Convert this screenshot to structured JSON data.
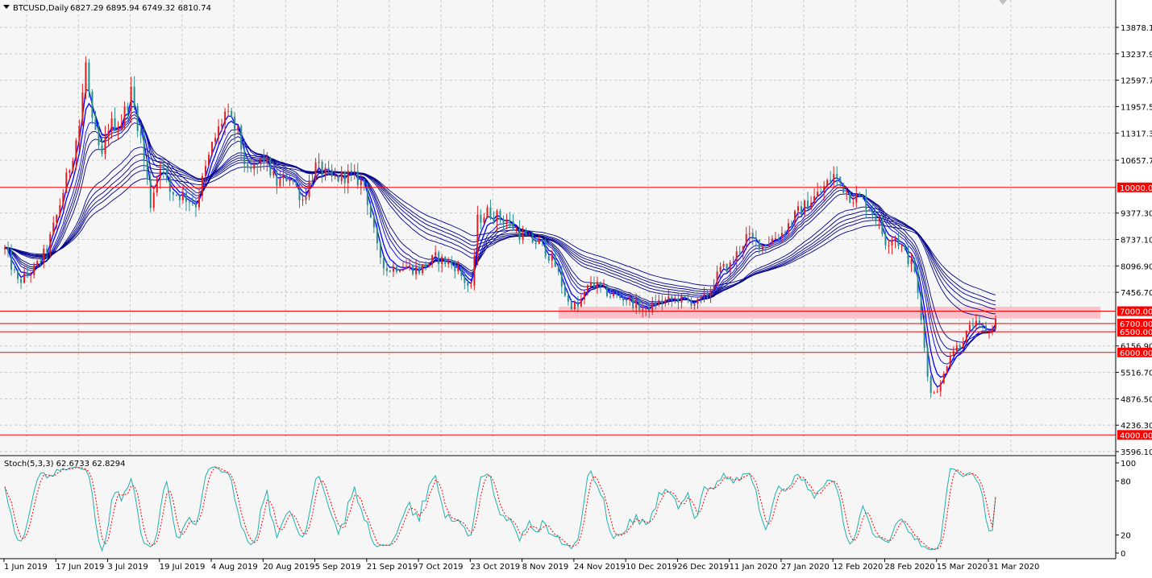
{
  "header": {
    "title": "BTCUSD,Daily",
    "ohlc": "6827.29 6895.94 6749.32 6810.74"
  },
  "colors": {
    "background": "#ffffff",
    "plot_bg": "#f6f6f6",
    "grid": "#c8c8c8",
    "bull_candle": "#e02020",
    "bear_candle": "#2e8b8b",
    "ma_line": "#00008b",
    "level_line": "#ff0000",
    "level_label_bg": "#ff0000",
    "level_label_text": "#ffffff",
    "zone_fill": "#ffb6c1",
    "stoch_main": "#20b2aa",
    "stoch_signal": "#ff0000",
    "axis_text": "#000000"
  },
  "price_axis": {
    "ticks": [
      "13878.10",
      "13237.90",
      "12597.70",
      "11957.50",
      "11317.30",
      "10657.70",
      "9377.30",
      "8737.10",
      "8096.90",
      "7456.70",
      "6156.90",
      "5516.70",
      "4876.50",
      "4236.30",
      "3596.10"
    ]
  },
  "levels": [
    {
      "label": "10000.00",
      "price": 10000
    },
    {
      "label": "7000.00",
      "price": 7000
    },
    {
      "label": "6700.00",
      "price": 6700
    },
    {
      "label": "6500.00",
      "price": 6500
    },
    {
      "label": "6000.00",
      "price": 6000
    },
    {
      "label": "4000.00",
      "price": 4000
    }
  ],
  "zone": {
    "from_price": 6900,
    "to_price": 7050
  },
  "date_axis": {
    "labels": [
      "1 Jun 2019",
      "17 Jun 2019",
      "3 Jul 2019",
      "19 Jul 2019",
      "4 Aug 2019",
      "20 Aug 2019",
      "5 Sep 2019",
      "21 Sep 2019",
      "7 Oct 2019",
      "23 Oct 2019",
      "8 Nov 2019",
      "24 Nov 2019",
      "10 Dec 2019",
      "26 Dec 2019",
      "11 Jan 2020",
      "27 Jan 2020",
      "12 Feb 2020",
      "28 Feb 2020",
      "15 Mar 2020",
      "31 Mar 2020"
    ]
  },
  "stoch": {
    "label": "Stoch(5,3,3) 62.6733 62.8294",
    "ticks": [
      "100",
      "80",
      "20",
      "0"
    ]
  },
  "chart_data": {
    "type": "candlestick",
    "symbol": "BTCUSD",
    "timeframe": "Daily",
    "last_ohlc": {
      "open": 6827.29,
      "high": 6895.94,
      "low": 6749.32,
      "close": 6810.74
    },
    "ylim": [
      3596.1,
      14200
    ],
    "price_path": [
      [
        "1 Jun 2019",
        8500
      ],
      [
        "5 Jun 2019",
        7700
      ],
      [
        "10 Jun 2019",
        8000
      ],
      [
        "14 Jun 2019",
        8500
      ],
      [
        "17 Jun 2019",
        9300
      ],
      [
        "21 Jun 2019",
        10500
      ],
      [
        "24 Jun 2019",
        11500
      ],
      [
        "26 Jun 2019",
        13000
      ],
      [
        "28 Jun 2019",
        11500
      ],
      [
        "1 Jul 2019",
        10700
      ],
      [
        "3 Jul 2019",
        11500
      ],
      [
        "7 Jul 2019",
        11600
      ],
      [
        "10 Jul 2019",
        12300
      ],
      [
        "13 Jul 2019",
        11200
      ],
      [
        "16 Jul 2019",
        9600
      ],
      [
        "19 Jul 2019",
        10600
      ],
      [
        "22 Jul 2019",
        9900
      ],
      [
        "26 Jul 2019",
        9800
      ],
      [
        "30 Jul 2019",
        9600
      ],
      [
        "4 Aug 2019",
        11000
      ],
      [
        "8 Aug 2019",
        11800
      ],
      [
        "12 Aug 2019",
        11300
      ],
      [
        "15 Aug 2019",
        10300
      ],
      [
        "20 Aug 2019",
        10700
      ],
      [
        "24 Aug 2019",
        10100
      ],
      [
        "28 Aug 2019",
        10300
      ],
      [
        "1 Sep 2019",
        9700
      ],
      [
        "5 Sep 2019",
        10500
      ],
      [
        "10 Sep 2019",
        10200
      ],
      [
        "15 Sep 2019",
        10300
      ],
      [
        "20 Sep 2019",
        10100
      ],
      [
        "24 Sep 2019",
        8500
      ],
      [
        "27 Sep 2019",
        8000
      ],
      [
        "1 Oct 2019",
        8100
      ],
      [
        "7 Oct 2019",
        8000
      ],
      [
        "12 Oct 2019",
        8300
      ],
      [
        "18 Oct 2019",
        8100
      ],
      [
        "23 Oct 2019",
        7500
      ],
      [
        "25 Oct 2019",
        9200
      ],
      [
        "28 Oct 2019",
        9400
      ],
      [
        "3 Nov 2019",
        9200
      ],
      [
        "8 Nov 2019",
        8800
      ],
      [
        "14 Nov 2019",
        8600
      ],
      [
        "18 Nov 2019",
        8100
      ],
      [
        "22 Nov 2019",
        7200
      ],
      [
        "25 Nov 2019",
        7100
      ],
      [
        "29 Nov 2019",
        7700
      ],
      [
        "5 Dec 2019",
        7400
      ],
      [
        "10 Dec 2019",
        7300
      ],
      [
        "16 Dec 2019",
        7000
      ],
      [
        "19 Dec 2019",
        7200
      ],
      [
        "26 Dec 2019",
        7300
      ],
      [
        "1 Jan 2020",
        7200
      ],
      [
        "4 Jan 2020",
        7400
      ],
      [
        "8 Jan 2020",
        8000
      ],
      [
        "11 Jan 2020",
        8100
      ],
      [
        "16 Jan 2020",
        8800
      ],
      [
        "21 Jan 2020",
        8600
      ],
      [
        "27 Jan 2020",
        8900
      ],
      [
        "1 Feb 2020",
        9400
      ],
      [
        "8 Feb 2020",
        9900
      ],
      [
        "12 Feb 2020",
        10300
      ],
      [
        "17 Feb 2020",
        9800
      ],
      [
        "21 Feb 2020",
        9700
      ],
      [
        "25 Feb 2020",
        9300
      ],
      [
        "28 Feb 2020",
        8700
      ],
      [
        "2 Mar 2020",
        8800
      ],
      [
        "8 Mar 2020",
        8000
      ],
      [
        "12 Mar 2020",
        5500
      ],
      [
        "13 Mar 2020",
        5000
      ],
      [
        "16 Mar 2020",
        5200
      ],
      [
        "19 Mar 2020",
        6000
      ],
      [
        "22 Mar 2020",
        6200
      ],
      [
        "26 Mar 2020",
        6700
      ],
      [
        "31 Mar 2020",
        6500
      ],
      [
        "2 Apr 2020",
        6800
      ]
    ],
    "moving_averages": 10,
    "indicator": {
      "name": "Stochastic",
      "params": [
        5,
        3,
        3
      ],
      "main": 62.6733,
      "signal": 62.8294,
      "ylim": [
        0,
        100
      ]
    }
  }
}
